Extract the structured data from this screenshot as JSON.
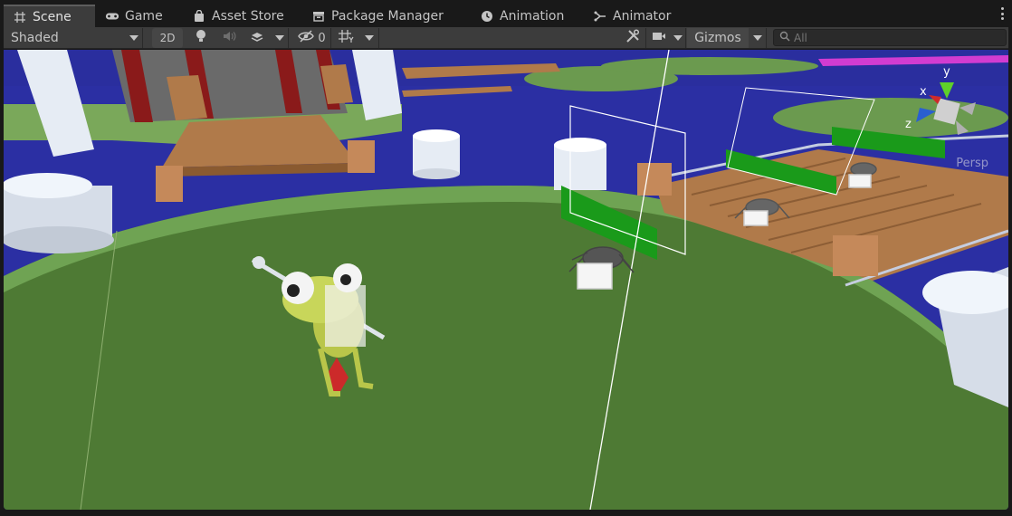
{
  "tabs": [
    {
      "label": "Scene",
      "icon": "grid-icon",
      "active": true
    },
    {
      "label": "Game",
      "icon": "gamepad-icon",
      "active": false
    },
    {
      "label": "Asset Store",
      "icon": "shopping-bag-icon",
      "active": false
    },
    {
      "label": "Package Manager",
      "icon": "package-icon",
      "active": false
    },
    {
      "label": "Animation",
      "icon": "clock-icon",
      "active": false
    },
    {
      "label": "Animator",
      "icon": "animator-icon",
      "active": false
    }
  ],
  "toolbar": {
    "shading_mode": "Shaded",
    "mode_2d": "2D",
    "hidden_count": "0",
    "gizmos_label": "Gizmos",
    "search_placeholder": "All"
  },
  "scene_gizmo": {
    "projection_label": "Persp",
    "axis_x": "x",
    "axis_y": "y",
    "axis_z": "z"
  },
  "colors": {
    "tab_active": "#3c3c3c",
    "toolbar": "#3c3c3c",
    "background": "#191919",
    "water": "#2b2fa3",
    "grass": "#4e7a34",
    "wood": "#b07a4a"
  }
}
